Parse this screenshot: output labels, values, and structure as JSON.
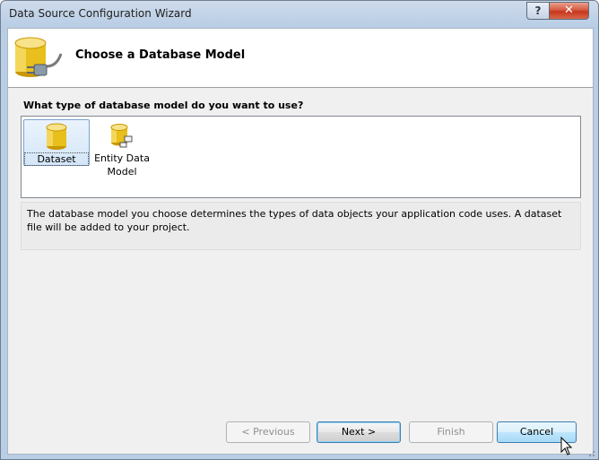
{
  "window": {
    "title": "Data Source Configuration Wizard",
    "help_glyph": "?",
    "close_glyph": "✕"
  },
  "header": {
    "title": "Choose a Database Model",
    "icon": "database-plug-icon"
  },
  "question": "What type of database model do you want to use?",
  "models": [
    {
      "label": "Dataset",
      "icon": "database-cylinder-icon",
      "selected": true
    },
    {
      "label_line1": "Entity Data",
      "label_line2": "Model",
      "icon": "entity-data-model-icon",
      "selected": false
    }
  ],
  "description": "The database model you choose determines the types of data objects your application code uses. A dataset file will be added to your project.",
  "buttons": {
    "previous": "< Previous",
    "next": "Next >",
    "finish": "Finish",
    "cancel": "Cancel"
  },
  "colors": {
    "accent": "#3c7fb1",
    "selection": "#d4e6f8",
    "database_gold": "#e2b400"
  }
}
